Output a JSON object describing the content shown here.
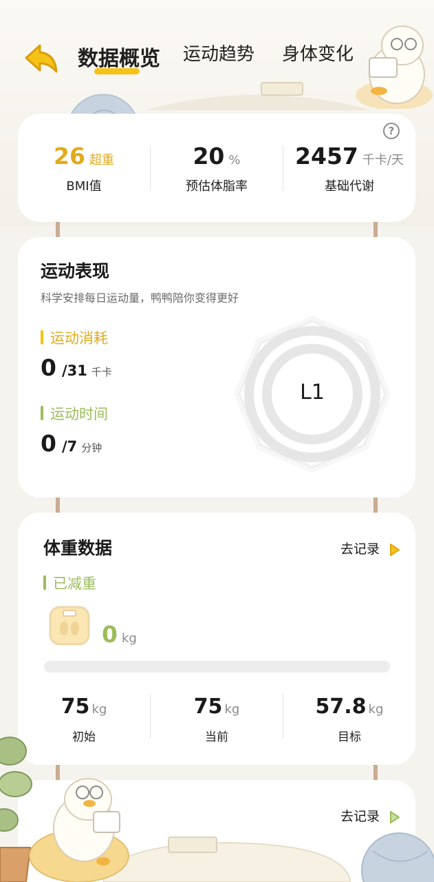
{
  "header": {
    "tabs": [
      {
        "label": "数据概览",
        "active": true
      },
      {
        "label": "运动趋势",
        "active": false
      },
      {
        "label": "身体变化",
        "active": false
      }
    ],
    "back_icon": "back-arrow-icon"
  },
  "stats": {
    "bmi": {
      "value": "26",
      "unit": "超重",
      "label": "BMI值"
    },
    "body_fat": {
      "value": "20",
      "unit": "%",
      "label": "预估体脂率"
    },
    "metabolism": {
      "value": "2457",
      "unit": "千卡/天",
      "label": "基础代谢"
    },
    "help_icon": "?"
  },
  "exercise": {
    "title": "运动表现",
    "subtitle": "科学安排每日运动量，鸭鸭陪你变得更好",
    "calories": {
      "label": "运动消耗",
      "current": "0",
      "target": "/31",
      "unit": "千卡"
    },
    "time": {
      "label": "运动时间",
      "current": "0",
      "target": "/7",
      "unit": "分钟"
    },
    "level": "L1"
  },
  "weight": {
    "title": "体重数据",
    "record_label": "去记录",
    "lost_label": "已减重",
    "lost_value": "0",
    "lost_unit": "kg",
    "progress_fraction": 0,
    "initial": {
      "value": "75",
      "unit": "kg",
      "label": "初始"
    },
    "current": {
      "value": "75",
      "unit": "kg",
      "label": "当前"
    },
    "target": {
      "value": "57.8",
      "unit": "kg",
      "label": "目标"
    }
  },
  "bottom_card": {
    "record_label": "去记录"
  },
  "colors": {
    "accent_yellow": "#f5c218",
    "bmi_text": "#e3ab1a",
    "accent_green": "#9bbd5b",
    "rope": "#c9ac92"
  }
}
